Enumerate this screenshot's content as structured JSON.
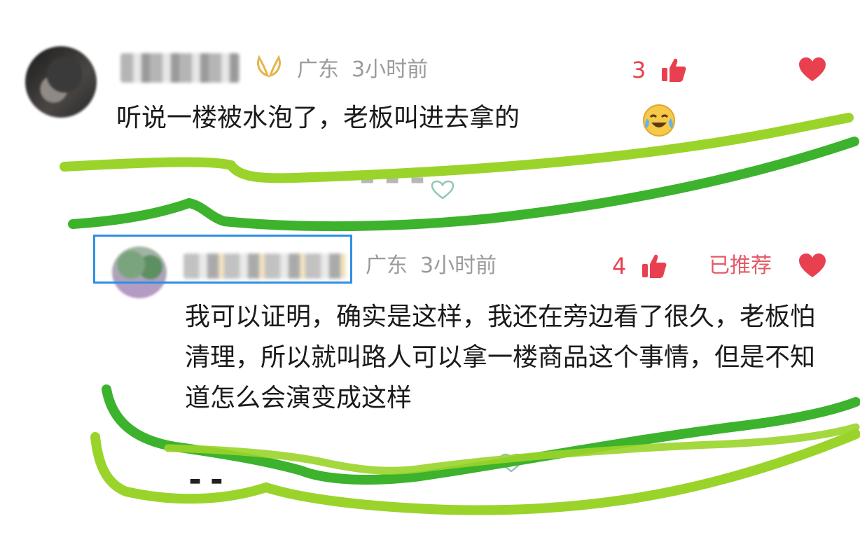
{
  "comments": [
    {
      "location": "广东",
      "time": "3小时前",
      "like_count": "3",
      "text": "听说一楼被水泡了，老板叫进去拿的",
      "badge_icon": "laurel-badge-icon",
      "emoji_icon": "crying-laughing-emoji-icon"
    },
    {
      "location": "广东",
      "time": "3小时前",
      "like_count": "4",
      "recommended_label": "已推荐",
      "text": "我可以证明，确实是这样，我还在旁边看了很久，老板怕清理，所以就叫路人可以拿一楼商品这个事情，但是不知道怎么会演变成这样"
    }
  ],
  "colors": {
    "like_red": "#e8404f",
    "scribble_light_green": "#9ad42a",
    "scribble_dark_green": "#3cb22d",
    "highlight_blue": "#2f8fe4",
    "meta_gray": "#9b9b9b"
  }
}
